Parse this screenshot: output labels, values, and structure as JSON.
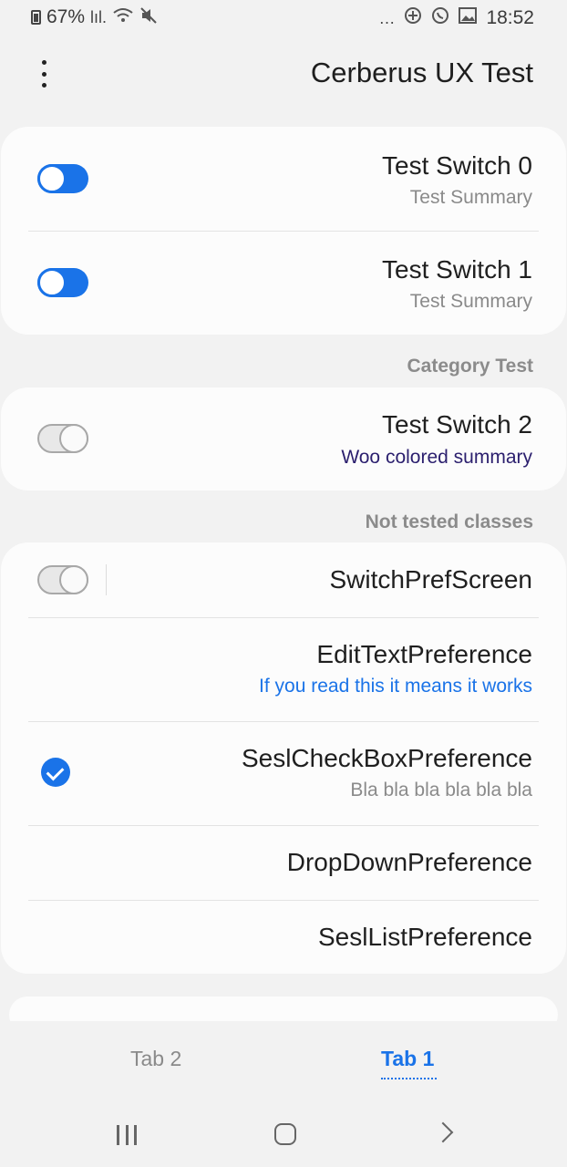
{
  "status_bar": {
    "battery": "67%",
    "signal": "lıl.",
    "time": "18:52",
    "more": "…",
    "left_icons": [
      "battery-icon",
      "signal-icon",
      "wifi-icon",
      "mute-icon"
    ],
    "right_icons": [
      "more-icon",
      "add-icon",
      "whatsapp-icon",
      "image-icon"
    ]
  },
  "app_bar": {
    "title": "Cerberus UX Test"
  },
  "sections": {
    "card1": {
      "rows": [
        {
          "title": "Test Switch 0",
          "summary": "Test Summary",
          "switch": "on"
        },
        {
          "title": "Test Switch 1",
          "summary": "Test Summary",
          "switch": "on"
        }
      ]
    },
    "category_test": {
      "label": "Category Test"
    },
    "card2": {
      "rows": [
        {
          "title": "Test Switch 2",
          "summary": "Woo colored summary",
          "summary_color": "#2b1f6e",
          "switch": "off"
        }
      ]
    },
    "not_tested": {
      "label": "Not tested classes"
    },
    "card3": {
      "rows": [
        {
          "title": "SwitchPrefScreen",
          "switch": "off"
        },
        {
          "title": "EditTextPreference",
          "summary": "If you read this it means it works",
          "summary_color": "#1a73e8"
        },
        {
          "title": "SeslCheckBoxPreference",
          "summary": "Bla bla bla bla bla bla",
          "checked": true
        },
        {
          "title": "DropDownPreference"
        },
        {
          "title": "SeslListPreference"
        }
      ]
    }
  },
  "tabs": [
    {
      "label": "Tab 2",
      "selected": false
    },
    {
      "label": "Tab 1",
      "selected": true
    }
  ],
  "colors": {
    "accent": "#1a73e8",
    "background": "#f2f2f2",
    "card": "#fcfcfc"
  }
}
